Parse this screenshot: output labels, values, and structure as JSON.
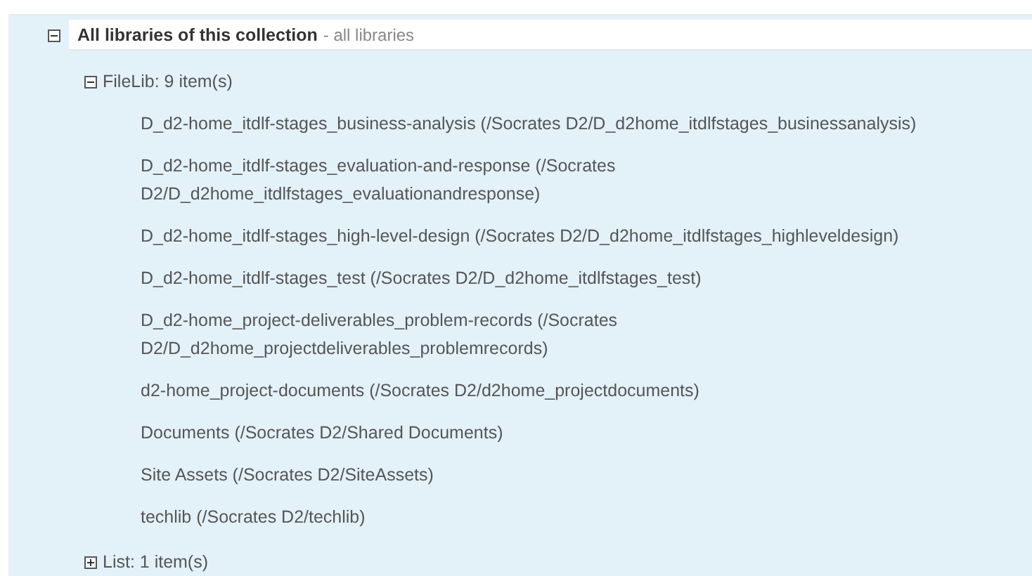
{
  "collection": {
    "title": "All libraries of this collection",
    "subtitle": "- all libraries",
    "expanded": true,
    "groups": [
      {
        "label": "FileLib: 9 item(s)",
        "expanded": true,
        "children": [
          {
            "label": "D_d2-home_itdlf-stages_business-analysis (/Socrates D2/D_d2home_itdlfstages_businessanalysis)"
          },
          {
            "label": "D_d2-home_itdlf-stages_evaluation-and-response (/Socrates D2/D_d2home_itdlfstages_evaluationandresponse)"
          },
          {
            "label": "D_d2-home_itdlf-stages_high-level-design (/Socrates D2/D_d2home_itdlfstages_highleveldesign)"
          },
          {
            "label": "D_d2-home_itdlf-stages_test (/Socrates D2/D_d2home_itdlfstages_test)"
          },
          {
            "label": "D_d2-home_project-deliverables_problem-records (/Socrates D2/D_d2home_projectdeliverables_problemrecords)"
          },
          {
            "label": "d2-home_project-documents (/Socrates D2/d2home_projectdocuments)"
          },
          {
            "label": "Documents (/Socrates D2/Shared Documents)"
          },
          {
            "label": "Site Assets (/Socrates D2/SiteAssets)"
          },
          {
            "label": "techlib (/Socrates D2/techlib)"
          }
        ]
      },
      {
        "label": "List: 1 item(s)",
        "expanded": false
      }
    ]
  }
}
